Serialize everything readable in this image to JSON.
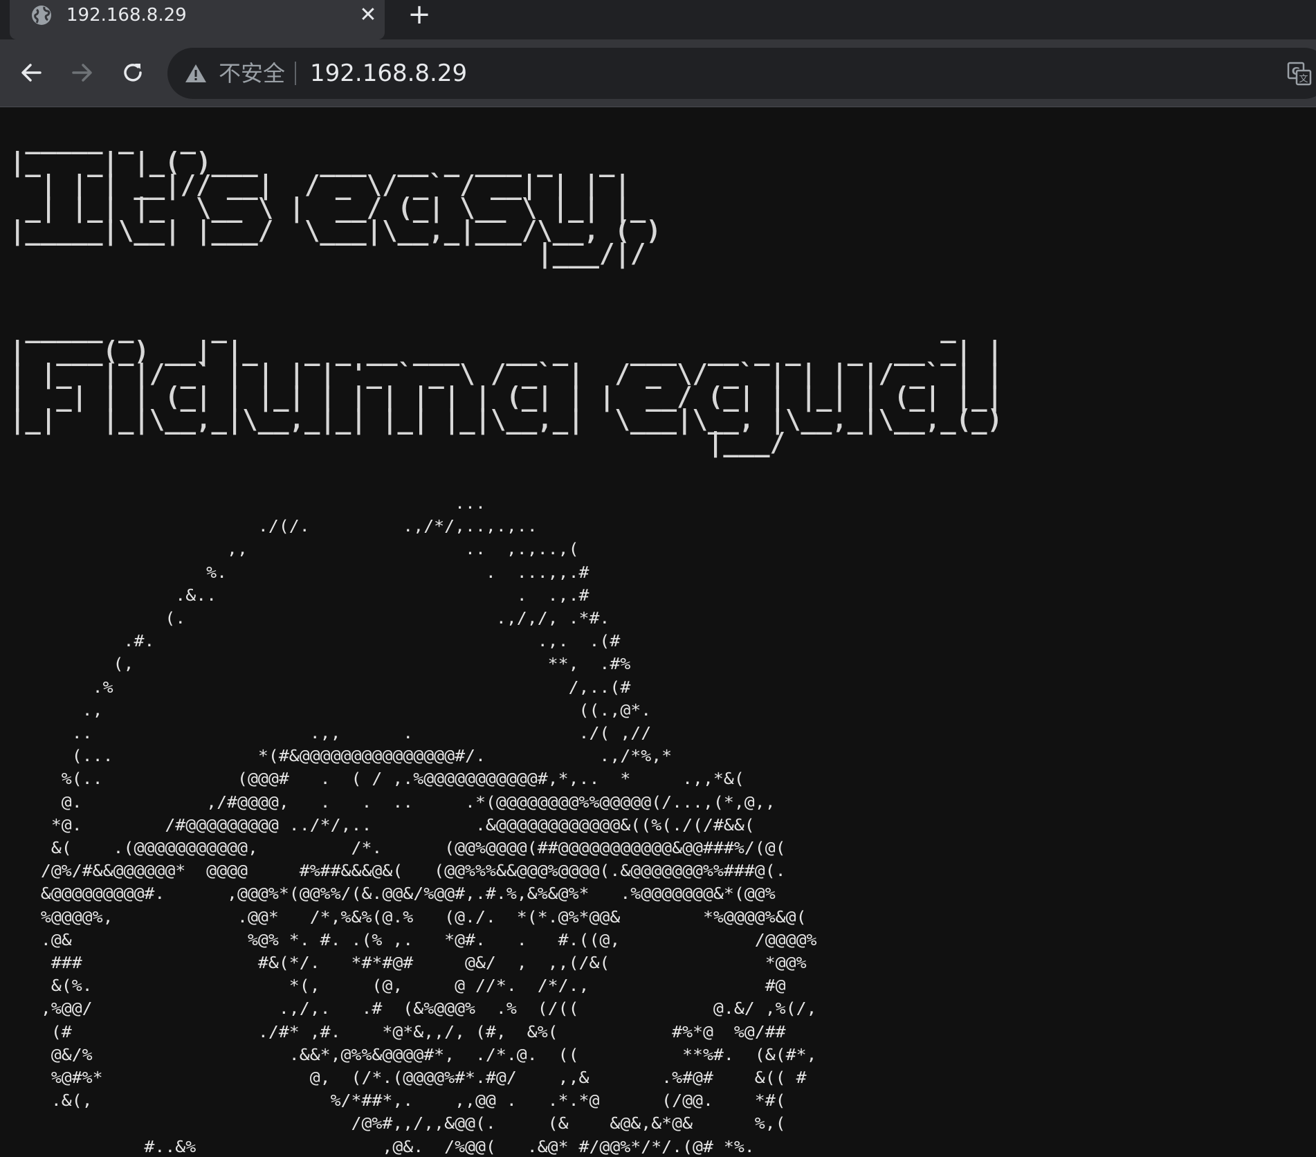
{
  "tab": {
    "title": "192.168.8.29",
    "close_glyph": "✕",
    "favicon": "globe-icon"
  },
  "new_tab_glyph": "+",
  "toolbar": {
    "back_icon": "back-arrow-icon",
    "forward_icon": "forward-arrow-icon",
    "reload_icon": "reload-icon",
    "security_label": "不安全",
    "url": "192.168.8.29",
    "translate_icon": "translate-icon"
  },
  "page": {
    "banner_line1": " _____ _   _\n|_   _| |_( )___    ___  __ _ ___ _   _\n  | | | __|// __|  / _ \\/ _` / __| | | |\n _| |_| |_  \\__ \\ |  __/ (_| \\__ \\ |_| |_\n|_____|\\__| |___/  \\___|\\__,_|___/\\__, ( )\n                                  |___/|/",
    "banner_line2": " _____ _     _                                              _\n|  ___(_) __| |_   _ _ __ ___   __ _    ___  __ _ _   _  __ _| |\n| |_  | |/ _` | | | | '_ ` _ \\ / _` |  / _ \\/ _` | | | |/ _` | |\n|  _| | | (_| | |_| | | | | | | (_| | |  __/ (_| | |_| | (_| |_|\n|_|   |_|\\__,_|\\__,_|_| |_| |_|\\__,_|  \\___|\\__, |\\__,_|\\__,_(_)\n                                             |___/",
    "ascii_art": "                                           ...\n                        ./(/.         .,/*/,..,.,..\n                     ,,                     ..  ,.,..,(\n                   %.                         .  ...,,.#\n                .&..                             .  .,.#\n               (.                              .,/,/, .*#.\n           .#.                                     .,.  .(#\n          (,                                        **,  .#%\n        .%                                            /,..(#\n       .,                                              ((.,@*.\n      ..                     .,,      .                ./( ,//\n      (...              *(#&@@@@@@@@@@@@@@@#/.           .,/*%,*\n     %(..             (@@@#   .  ( / ,.%@@@@@@@@@@@#,*,..  *     .,,*&(\n     @.            ,/#@@@@,   .   .  ..     .*(@@@@@@@@%%@@@@@(/...,(*,@,,\n    *@.        /#@@@@@@@@@ ../*/,..          .&@@@@@@@@@@@@&((%(./(/#&&(\n    &(    .(@@@@@@@@@@@,         /*.      (@@%@@@@(##@@@@@@@@@@@&@@###%/(@(\n   /@%/#&&@@@@@@*  @@@@     #%##&&&@&(   (@@%%%&&@@@%@@@@(.&@@@@@@@%%###@(.\n   &@@@@@@@@@#.      ,@@@%*(@@%%/(&.@@&/%@@#,.#.%,&%&@%*   .%@@@@@@@&*(@@%\n   %@@@@%,            .@@*   /*,%&%(@.%   (@./.  *(*.@%*@@&        *%@@@@%&@(\n   .@&                 %@% *. #. .(% ,.   *@#.   .   #.((@,             /@@@@%\n    ###                 #&(*/.   *#*#@#     @&/  ,  ,,(/&(               *@@%\n    &(%.                   *(,     (@,     @ //*.  /*/.,                 #@\n   ,%@@/                  .,/,.   .#  (&%@@@%  .%  (/((             @.&/ ,%(/,\n    (#                  ./#* ,#.    *@*&,,/, (#,  &%(           #%*@  %@/##\n    @&/%                   .&&*,@%%&@@@@#*,  ./*.@.  ((          **%#.  (&(#*,\n    %@#%*                    @,  (/*.(@@@@%#*.#@/    ,,&       .%#@#    &(( #\n    .&(,                       %/*##*,.    ,,@@ .   .*.*@      (/@@.    *#(\n                                 /@%#,,/,,&@@(.     (&    &@&,&*@&      %,(\n             #..&%                  ,@&.  /%@@(   .&@* #/@@%*/*/.(@# *%."
  }
}
